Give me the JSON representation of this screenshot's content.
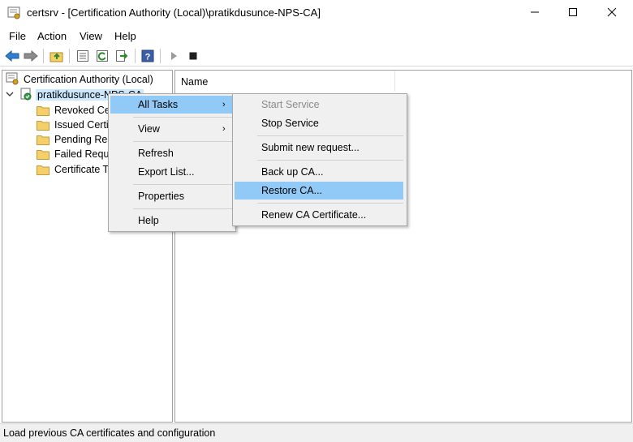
{
  "window": {
    "title": "certsrv - [Certification Authority (Local)\\pratikdusunce-NPS-CA]",
    "icon": "certsrv-app-icon",
    "controls": [
      "minimize-icon",
      "maximize-icon",
      "close-icon"
    ]
  },
  "menu": {
    "file": "File",
    "action": "Action",
    "view": "View",
    "help": "Help"
  },
  "toolbar": {
    "icons": [
      "back-arrow-icon",
      "forward-arrow-icon",
      "up-folder-icon",
      "properties-icon",
      "refresh-icon",
      "export-icon",
      "help-icon",
      "play-icon",
      "stop-icon"
    ]
  },
  "tree": {
    "root": "Certification Authority (Local)",
    "ca_node": "pratikdusunce-NPS-CA",
    "children": [
      "Revoked Certificates",
      "Issued Certificates",
      "Pending Requests",
      "Failed Requests",
      "Certificate Templates"
    ],
    "children_visible": [
      "Revoked Cer",
      "Issued Certif",
      "Pending Req",
      "Failed Reque",
      "Certificate T"
    ]
  },
  "list": {
    "column_name": "Name"
  },
  "context_menu": {
    "all_tasks": "All Tasks",
    "view": "View",
    "refresh": "Refresh",
    "export_list": "Export List...",
    "properties": "Properties",
    "help": "Help"
  },
  "submenu": {
    "start_service": "Start Service",
    "stop_service": "Stop Service",
    "submit_request": "Submit new request...",
    "backup_ca": "Back up CA...",
    "restore_ca": "Restore CA...",
    "renew_ca": "Renew CA Certificate..."
  },
  "status": {
    "text": "Load previous CA certificates and configuration"
  },
  "colors": {
    "highlight": "#91c9f7",
    "menu_bg": "#f0f0f0",
    "folder": "#f5cf6a",
    "disabled_text": "#8a8a8a"
  }
}
